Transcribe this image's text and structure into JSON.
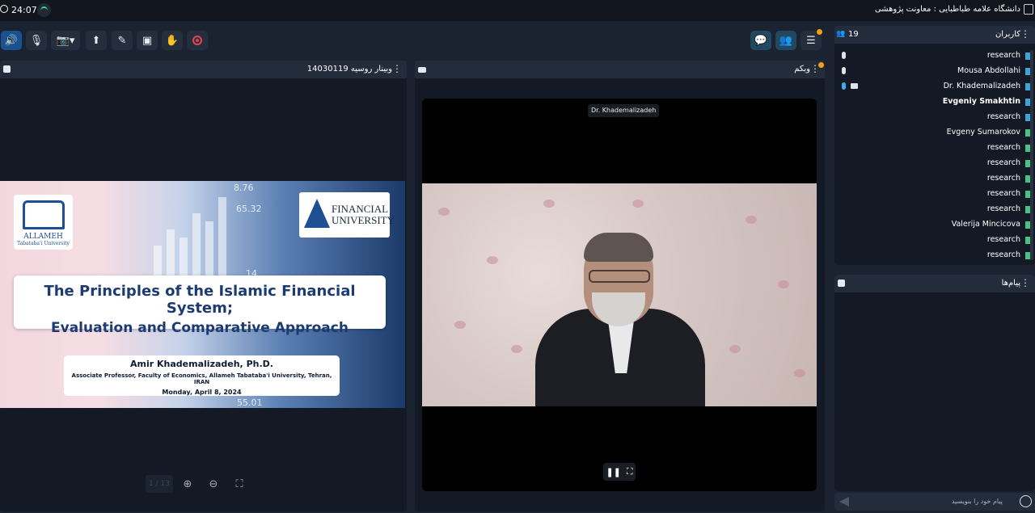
{
  "statusbar": {
    "time": "24:07",
    "title": "دانشگاه علامه طباطبایی : معاونت پژوهشی"
  },
  "toolbar": {
    "buttons": [
      "speaker",
      "mic-muted",
      "camera-off",
      "share-screen",
      "whiteboard",
      "files",
      "raise-hand",
      "record"
    ],
    "right_buttons": [
      "chat",
      "participants",
      "menu"
    ]
  },
  "presentation": {
    "panel_title": "وبینار روسیه 14030119",
    "slide": {
      "logo_left": {
        "name": "ALLAMEH",
        "sub": "Tabataba'i University"
      },
      "logo_right": {
        "name1": "FINANCIAL",
        "name2": "UNIVERSITY"
      },
      "title_line1": "The Principles of the Islamic Financial System;",
      "title_line2": "Evaluation and Comparative Approach",
      "author": "Amir  Khademalizadeh, Ph.D.",
      "affiliation": "Associate Professor, Faculty of Economics, Allameh Tabataba'i University, Tehran, IRAN",
      "date": "Monday, April 8, 2024",
      "numbers": [
        "8.76",
        "65.32",
        "14",
        "55.01"
      ]
    },
    "controls": {
      "page": "1 / 13"
    }
  },
  "webcam": {
    "panel_title": "وبکم",
    "speaker_label": "Dr. Khademalizadeh"
  },
  "users": {
    "panel_title": "کاربران",
    "count": "19",
    "list": [
      {
        "name": "research",
        "bold": false,
        "color": "blue",
        "mic": true,
        "mic_active": false,
        "cam": false
      },
      {
        "name": "Mousa Abdollahi",
        "bold": false,
        "color": "blue",
        "mic": true,
        "mic_active": false,
        "cam": false
      },
      {
        "name": "Dr. Khademalizadeh",
        "bold": false,
        "color": "blue",
        "mic": true,
        "mic_active": true,
        "cam": true
      },
      {
        "name": "Evgeniy Smakhtin",
        "bold": true,
        "color": "blue",
        "mic": false,
        "mic_active": false,
        "cam": false
      },
      {
        "name": "research",
        "bold": false,
        "color": "blue",
        "mic": false,
        "mic_active": false,
        "cam": false
      },
      {
        "name": "Evgeny Sumarokov",
        "bold": false,
        "color": "green",
        "mic": false,
        "mic_active": false,
        "cam": false
      },
      {
        "name": "research",
        "bold": false,
        "color": "green",
        "mic": false,
        "mic_active": false,
        "cam": false
      },
      {
        "name": "research",
        "bold": false,
        "color": "green",
        "mic": false,
        "mic_active": false,
        "cam": false
      },
      {
        "name": "research",
        "bold": false,
        "color": "green",
        "mic": false,
        "mic_active": false,
        "cam": false
      },
      {
        "name": "research",
        "bold": false,
        "color": "green",
        "mic": false,
        "mic_active": false,
        "cam": false
      },
      {
        "name": "research",
        "bold": false,
        "color": "green",
        "mic": false,
        "mic_active": false,
        "cam": false
      },
      {
        "name": "Valerija Mincicova",
        "bold": false,
        "color": "green",
        "mic": false,
        "mic_active": false,
        "cam": false
      },
      {
        "name": "research",
        "bold": false,
        "color": "green",
        "mic": false,
        "mic_active": false,
        "cam": false
      },
      {
        "name": "research",
        "bold": false,
        "color": "green",
        "mic": false,
        "mic_active": false,
        "cam": false
      }
    ]
  },
  "messages": {
    "panel_title": "پیام‌ها",
    "placeholder": "پیام خود را بنویسید"
  },
  "colors": {
    "accent": "#19528f",
    "notify": "#f1a20f",
    "user_blue": "#3da3d8",
    "user_green": "#4bbf84",
    "record": "#e04552"
  }
}
